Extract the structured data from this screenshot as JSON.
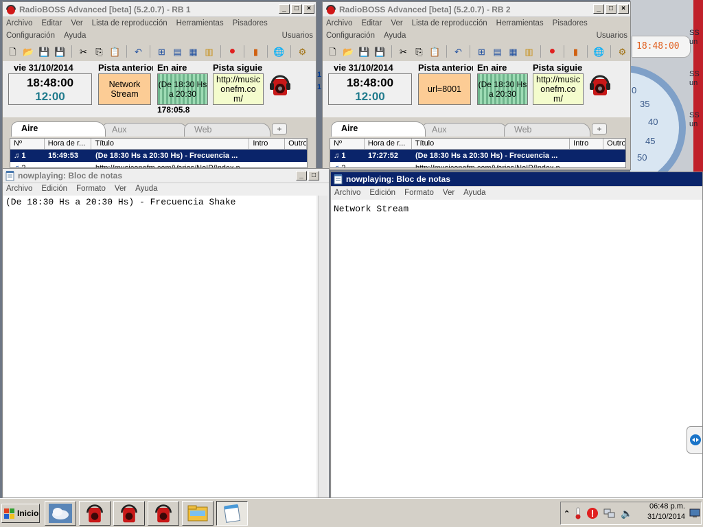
{
  "background_widgets": {
    "timer": "18:48:00",
    "gauge_ticks": [
      "0",
      "35",
      "40",
      "45",
      "50"
    ],
    "right_labels": [
      "SS",
      "un",
      "SS",
      "un",
      "SS",
      "un"
    ],
    "left_margin": [
      "1",
      "1"
    ]
  },
  "rb1": {
    "title": "RadioBOSS Advanced [beta] (5.2.0.7) - RB 1",
    "menu1": [
      "Archivo",
      "Editar",
      "Ver",
      "Lista de reproducción",
      "Herramientas",
      "Pisadores"
    ],
    "menu2": [
      "Configuración",
      "Ayuda"
    ],
    "users": "Usuarios",
    "date": "vie 31/10/2014",
    "time": "18:48:00",
    "time2": "12:00",
    "prev_label": "Pista anterior",
    "prev_value": "Network Stream",
    "onair_label": "En aire",
    "onair_value": "(De 18:30 Hs a 20:30",
    "onair_time": "178:05.8",
    "next_label": "Pista siguiente",
    "next_value": "http://musiconefm.com/",
    "tabs": [
      "Aire",
      "Aux",
      "Web"
    ],
    "cols": [
      "Nº",
      "Hora de r...",
      "Título",
      "Intro",
      "Outro"
    ],
    "row1": {
      "num": "1",
      "time": "15:49:53",
      "title": "(De 18:30 Hs a 20:30 Hs) - Frecuencia ..."
    },
    "row2": {
      "num": "2",
      "title": "http://musiconefm.com/Varios/NoIP/Index.p..."
    }
  },
  "rb2": {
    "title": "RadioBOSS Advanced [beta] (5.2.0.7) - RB 2",
    "menu1": [
      "Archivo",
      "Editar",
      "Ver",
      "Lista de reproducción",
      "Herramientas",
      "Pisadores"
    ],
    "menu2": [
      "Configuración",
      "Ayuda"
    ],
    "users": "Usuarios",
    "date": "vie 31/10/2014",
    "time": "18:48:00",
    "time2": "12:00",
    "prev_label": "Pista anterior",
    "prev_value": "url=8001",
    "onair_label": "En aire",
    "onair_value": "(De 18:30 Hs a 20:30",
    "next_label": "Pista siguiente",
    "next_value": "http://musiconefm.com/",
    "tabs": [
      "Aire",
      "Aux",
      "Web"
    ],
    "cols": [
      "Nº",
      "Hora de r...",
      "Título",
      "Intro",
      "Outro"
    ],
    "row1": {
      "num": "1",
      "time": "17:27:52",
      "title": "(De 18:30 Hs a 20:30 Hs) - Frecuencia ..."
    },
    "row2": {
      "num": "2",
      "title": "http://musiconefm.com/Varios/NoIP/Index.p..."
    }
  },
  "np1": {
    "title": "nowplaying: Bloc de notas",
    "menu": [
      "Archivo",
      "Edición",
      "Formato",
      "Ver",
      "Ayuda"
    ],
    "content": "(De 18:30 Hs a 20:30 Hs) - Frecuencia Shake"
  },
  "np2": {
    "title": "nowplaying: Bloc de notas",
    "menu": [
      "Archivo",
      "Edición",
      "Formato",
      "Ver",
      "Ayuda"
    ],
    "content": "Network Stream"
  },
  "taskbar": {
    "start": "Inicio",
    "time": "06:48 p.m.",
    "date": "31/10/2014"
  },
  "colors": {
    "selected_row": "#0a246a",
    "prev_box": "#fccc95",
    "next_box": "#f4fccd",
    "onair_box": "#8fd3a7",
    "clock_secondary": "#1f7a8c"
  }
}
